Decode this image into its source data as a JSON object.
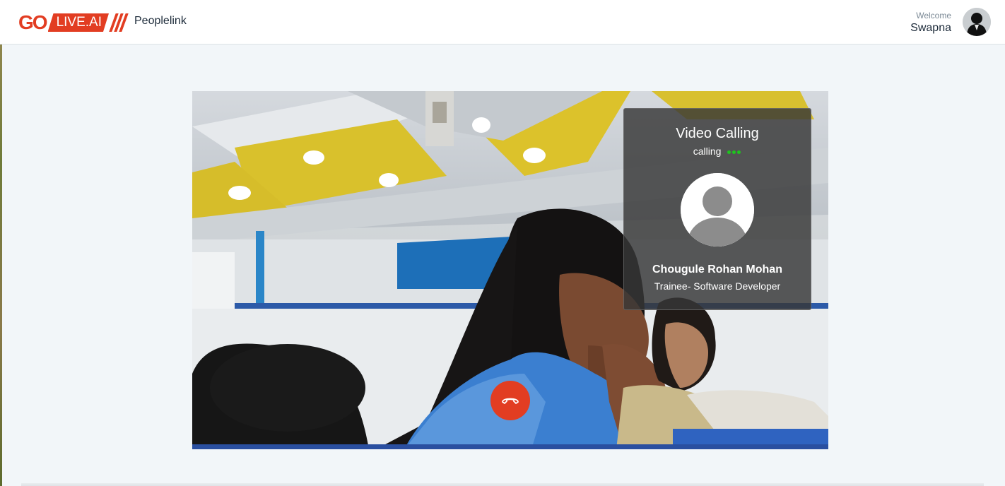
{
  "header": {
    "logo": {
      "text_go": "GO",
      "text_live": "LIVE.AI"
    },
    "brand": "Peoplelink",
    "welcome_label": "Welcome",
    "user_name": "Swapna",
    "user_avatar_icon": "user-silhouette-icon"
  },
  "call": {
    "title": "Video Calling",
    "status": "calling",
    "status_dot_color": "#1ec41e",
    "callee_avatar_icon": "default-user-avatar-icon",
    "callee_name": "Chougule Rohan Mohan",
    "callee_role": "Trainee- Software Developer",
    "hangup_icon": "phone-hangup-icon"
  },
  "colors": {
    "accent": "#e23d22",
    "card_background": "rgba(55,55,55,0.82)",
    "page_background": "#f2f6f9"
  }
}
